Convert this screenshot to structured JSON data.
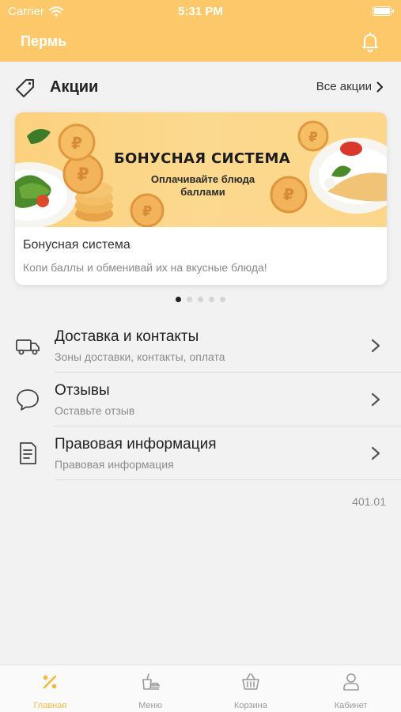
{
  "status_bar": {
    "carrier": "Carrier",
    "time": "5:31 PM"
  },
  "header": {
    "city": "Пермь"
  },
  "promotions": {
    "title": "Акции",
    "all_link": "Все акции",
    "card": {
      "banner_heading": "БОНУСНАЯ СИСТЕМА",
      "banner_sub": "Оплачивайте блюда баллами",
      "title": "Бонусная система",
      "description": "Копи баллы и обменивай их на вкусные блюда!"
    },
    "dots_total": 5,
    "dots_active_index": 0
  },
  "menu": [
    {
      "title": "Доставка и контакты",
      "subtitle": "Зоны доставки, контакты, оплата",
      "icon": "truck-icon"
    },
    {
      "title": "Отзывы",
      "subtitle": "Оставьте отзыв",
      "icon": "speech-bubble-icon"
    },
    {
      "title": "Правовая информация",
      "subtitle": "Правовая информация",
      "icon": "document-icon"
    }
  ],
  "version": "401.01",
  "tabbar": [
    {
      "label": "Главная",
      "icon": "percent-icon",
      "active": true
    },
    {
      "label": "Меню",
      "icon": "food-icon",
      "active": false
    },
    {
      "label": "Корзина",
      "icon": "basket-icon",
      "active": false
    },
    {
      "label": "Кабинет",
      "icon": "user-icon",
      "active": false
    }
  ],
  "colors": {
    "accent": "#fcc86a",
    "active_tab": "#f5b93e",
    "background": "#f2f2f2"
  }
}
